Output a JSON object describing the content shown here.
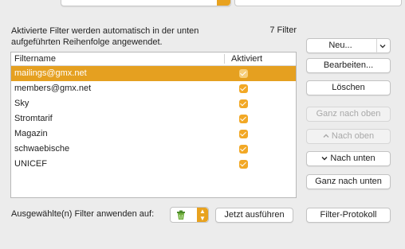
{
  "description": "Aktivierte Filter werden automatisch in der unten aufgeführten Reihenfolge angewendet.",
  "filter_count": "7 Filter",
  "table": {
    "headers": {
      "name": "Filtername",
      "active": "Aktiviert"
    },
    "rows": [
      {
        "name": "mailings@gmx.net",
        "active": true,
        "selected": true
      },
      {
        "name": "members@gmx.net",
        "active": true,
        "selected": false
      },
      {
        "name": "Sky",
        "active": true,
        "selected": false
      },
      {
        "name": "Stromtarif",
        "active": true,
        "selected": false
      },
      {
        "name": "Magazin",
        "active": true,
        "selected": false
      },
      {
        "name": "schwaebische",
        "active": true,
        "selected": false
      },
      {
        "name": "UNICEF",
        "active": true,
        "selected": false
      }
    ]
  },
  "buttons": {
    "new": "Neu...",
    "edit": "Bearbeiten...",
    "delete": "Löschen",
    "move_top": "Ganz nach oben",
    "move_up": "Nach oben",
    "move_down": "Nach unten",
    "move_bottom": "Ganz nach unten",
    "run_now": "Jetzt ausführen",
    "filter_log": "Filter-Protokoll"
  },
  "apply_label": "Ausgewählte(n) Filter anwenden auf:",
  "colors": {
    "accent": "#e5a020",
    "checkbox": "#f2a825",
    "window_bg": "#ececec"
  },
  "icons": {
    "apply_target": "trash-can-icon",
    "new_dropdown": "chevron-down-icon",
    "move_up": "chevron-up-icon",
    "move_down": "chevron-down-icon"
  }
}
